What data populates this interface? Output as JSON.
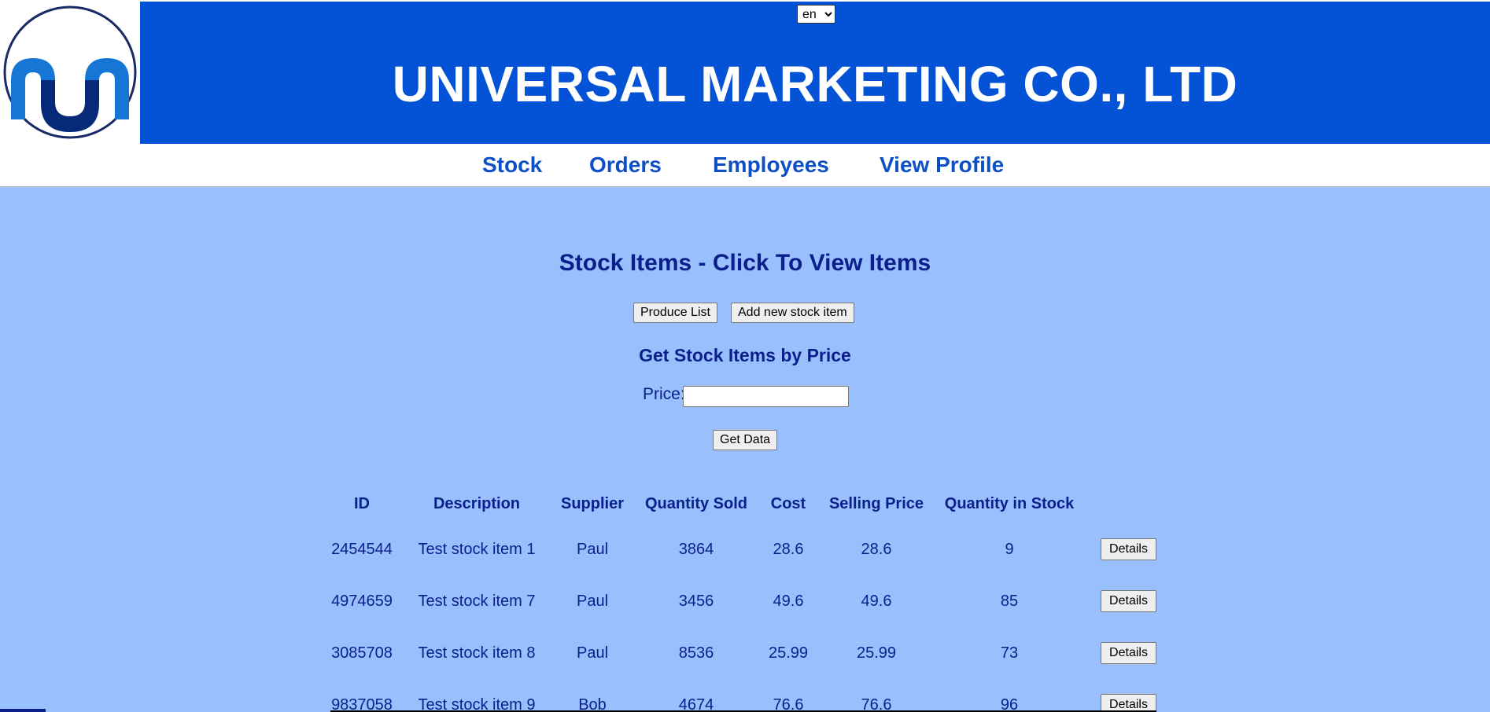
{
  "header": {
    "company_name": "UNIVERSAL MARKETING CO., LTD",
    "language": "en",
    "logo_icon": "company-logo-icon",
    "colors": {
      "header_bg": "#0452d6",
      "logo_dark": "#062a78",
      "logo_mid": "#1576d6"
    }
  },
  "nav": {
    "items": [
      {
        "label": "Stock"
      },
      {
        "label": "Orders"
      },
      {
        "label": "Employees"
      },
      {
        "label": "View Profile"
      }
    ]
  },
  "main": {
    "title": "Stock Items - Click To View Items",
    "produce_list_label": "Produce List",
    "add_item_label": "Add new stock item",
    "price_section_title": "Get Stock Items by Price",
    "price_label": "Price:",
    "price_value": "",
    "get_data_label": "Get Data",
    "background": "#99bffc"
  },
  "table": {
    "headers": [
      "ID",
      "Description",
      "Supplier",
      "Quantity Sold",
      "Cost",
      "Selling Price",
      "Quantity in Stock"
    ],
    "details_label": "Details",
    "rows": [
      {
        "id": "2454544",
        "description": "Test stock item 1",
        "supplier": "Paul",
        "quantity_sold": "3864",
        "cost": "28.6",
        "selling_price": "28.6",
        "quantity_in_stock": "9"
      },
      {
        "id": "4974659",
        "description": "Test stock item 7",
        "supplier": "Paul",
        "quantity_sold": "3456",
        "cost": "49.6",
        "selling_price": "49.6",
        "quantity_in_stock": "85"
      },
      {
        "id": "3085708",
        "description": "Test stock item 8",
        "supplier": "Paul",
        "quantity_sold": "8536",
        "cost": "25.99",
        "selling_price": "25.99",
        "quantity_in_stock": "73"
      },
      {
        "id": "9837058",
        "description": "Test stock item 9",
        "supplier": "Bob",
        "quantity_sold": "4674",
        "cost": "76.6",
        "selling_price": "76.6",
        "quantity_in_stock": "96"
      }
    ]
  }
}
